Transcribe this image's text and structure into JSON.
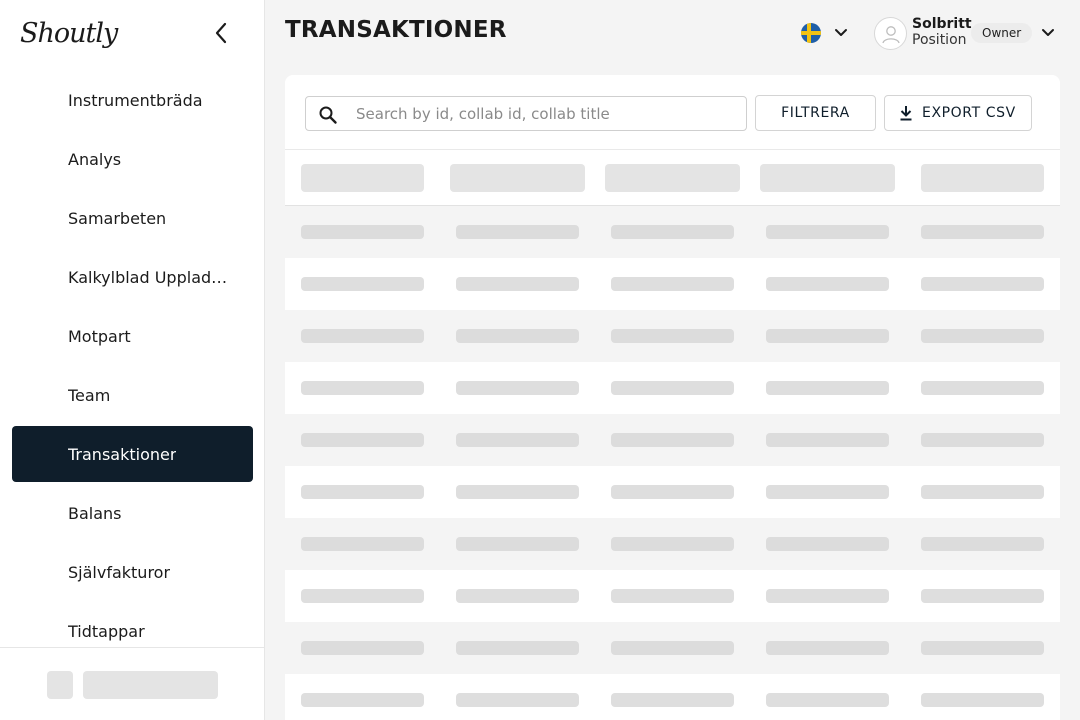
{
  "app": {
    "logo_text": "Shoutly"
  },
  "sidebar": {
    "items": [
      {
        "label": "Instrumentbräda",
        "active": false
      },
      {
        "label": "Analys",
        "active": false
      },
      {
        "label": "Samarbeten",
        "active": false
      },
      {
        "label": "Kalkylblad Uppladdningar",
        "active": false
      },
      {
        "label": "Motpart",
        "active": false
      },
      {
        "label": "Team",
        "active": false
      },
      {
        "label": "Transaktioner",
        "active": true
      },
      {
        "label": "Balans",
        "active": false
      },
      {
        "label": "Självfakturor",
        "active": false
      },
      {
        "label": "Tidtappar",
        "active": false
      }
    ]
  },
  "header": {
    "title": "TRANSAKTIONER",
    "language_flag": "sweden-flag-icon",
    "user": {
      "name": "Solbritt",
      "position": "Position",
      "role": "Owner"
    }
  },
  "toolbar": {
    "search_placeholder": "Search by id, collab id, collab title",
    "search_value": "",
    "filter_label": "FILTRERA",
    "export_label": "EXPORT CSV"
  },
  "table": {
    "state": "loading",
    "column_count": 5,
    "skeleton_row_count": 10
  },
  "colors": {
    "active_nav_bg": "#0f1e2b",
    "page_bg": "#f4f4f4",
    "skeleton": "#e2e2e2"
  }
}
